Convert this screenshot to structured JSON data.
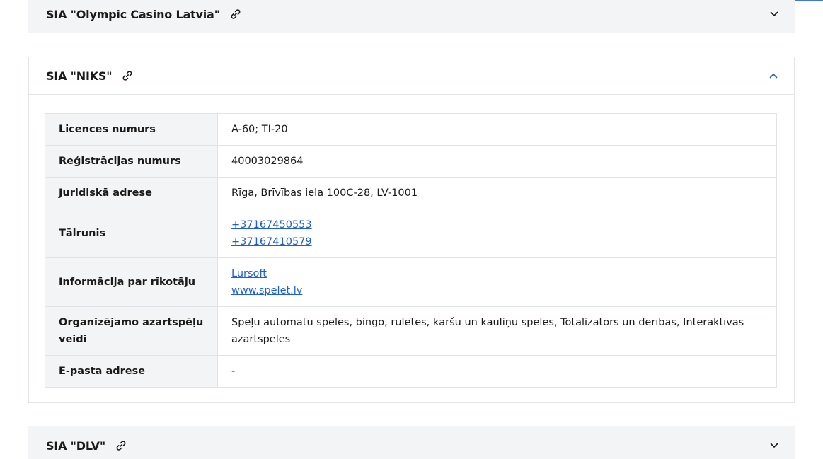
{
  "accordions": {
    "top": {
      "title": "SIA \"Olympic Casino Latvia\"",
      "expanded": false
    },
    "middle": {
      "title": "SIA \"NIKS\"",
      "expanded": true,
      "rows": {
        "license": {
          "label": "Licences numurs",
          "value": "A-60; TI-20"
        },
        "registration": {
          "label": "Reģistrācijas numurs",
          "value": "40003029864"
        },
        "address": {
          "label": "Juridiskā adrese",
          "value": "Rīga, Brīvības iela 100C-28, LV-1001"
        },
        "phone": {
          "label": "Tālrunis",
          "links": [
            "+37167450553",
            "+37167410579"
          ]
        },
        "info": {
          "label": "Informācija par rīkotāju",
          "links": [
            "Lursoft",
            "www.spelet.lv"
          ]
        },
        "types": {
          "label": "Organizējamo azartspēļu veidi",
          "value": "Spēļu automātu spēles, bingo, ruletes, kāršu un kauliņu spēles, Totalizators un derības, Interaktīvās azartspēles"
        },
        "email": {
          "label": "E-pasta adrese",
          "value": "-"
        }
      }
    },
    "bottom": {
      "title": "SIA \"DLV\"",
      "expanded": false
    }
  },
  "icons": {
    "link": "link-icon",
    "chevron_down": "chevron-down-icon",
    "chevron_up": "chevron-up-icon"
  },
  "colors": {
    "accent": "#1f5fd6",
    "header_bg": "#f3f4f6",
    "border": "#e1e3e6"
  }
}
